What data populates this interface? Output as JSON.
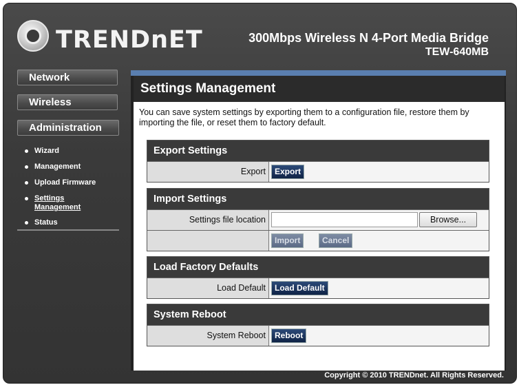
{
  "header": {
    "logo_text": "TRENDnET",
    "product_title": "300Mbps Wireless N 4-Port Media Bridge",
    "product_model": "TEW-640MB"
  },
  "nav": {
    "network": "Network",
    "wireless": "Wireless",
    "administration": "Administration",
    "submenu": [
      "Wizard",
      "Management",
      "Upload Firmware",
      "Settings Management",
      "Status"
    ]
  },
  "page": {
    "title": "Settings Management",
    "description": "You can save system settings by exporting them to a configuration file, restore them by importing the file, or reset them to factory default."
  },
  "export": {
    "heading": "Export Settings",
    "label": "Export",
    "button": "Export"
  },
  "import": {
    "heading": "Import Settings",
    "label": "Settings file location",
    "file_value": "",
    "browse_button": "Browse...",
    "import_button": "Import",
    "cancel_button": "Cancel"
  },
  "factory": {
    "heading": "Load Factory Defaults",
    "label": "Load Default",
    "button": "Load Default"
  },
  "reboot": {
    "heading": "System Reboot",
    "label": "System Reboot",
    "button": "Reboot"
  },
  "footer": {
    "copyright": "Copyright © 2010 TRENDnet. All Rights Reserved."
  },
  "colors": {
    "frame": "#3a3a3a",
    "accent_bar": "#5a7fb0",
    "button": "#0f2346"
  }
}
